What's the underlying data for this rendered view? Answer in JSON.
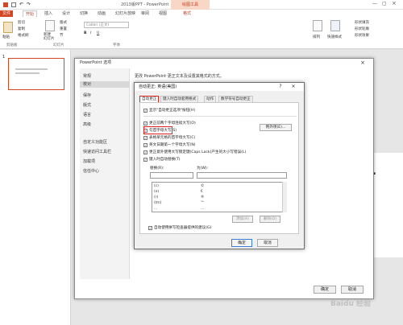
{
  "app": {
    "window_title": "2013版PPT - PowerPoint",
    "context_tools": "绘图工具"
  },
  "ribbon_tabs": [
    "文件",
    "开始",
    "插入",
    "设计",
    "切换",
    "动画",
    "幻灯片放映",
    "审阅",
    "视图",
    "格式"
  ],
  "ribbon_groups": {
    "clipboard": "剪贴板",
    "slides": "幻灯片",
    "font": "字体",
    "paste": "粘贴",
    "cut": "剪切",
    "copy": "复制",
    "format_painter": "格式刷",
    "new_slide": "新建\n幻灯片",
    "layout": "版式",
    "reset": "重置",
    "section": "节",
    "font_name": "Calibri (正文)",
    "arrange": "排列",
    "quick_styles": "快速样式",
    "shape_fill": "形状填充",
    "shape_outline": "形状轮廓",
    "shape_effects": "形状效果"
  },
  "slide_pane": {
    "slide_number": "1"
  },
  "options_dialog": {
    "title": "PowerPoint 选项",
    "header": "更改 PowerPoint 更正文本及设置其格式的方式。",
    "nav": [
      "常规",
      "校对",
      "保存",
      "版式",
      "语言",
      "高级",
      "",
      "自定义功能区",
      "快速访问工具栏",
      "",
      "加载项",
      "信任中心"
    ],
    "selected_nav": "校对",
    "ok": "确定",
    "cancel": "取消"
  },
  "autocorrect_dialog": {
    "title": "自动更正: 英语(美国)",
    "help": "?",
    "close": "×",
    "tabs": [
      "自动更正",
      "键入时自动套用格式",
      "动作",
      "数学符号自动更正"
    ],
    "active_tab": "自动更正",
    "show_buttons": "显示\"自动更正选项\"按钮(H)",
    "checkboxes": [
      {
        "label": "更正前两个字母连续大写(O)",
        "checked": true
      },
      {
        "label": "句首字母大写(S)",
        "checked": true
      },
      {
        "label": "表格单元格的首字母大写(C)",
        "checked": true
      },
      {
        "label": "英文日期第一个字母大写(N)",
        "checked": true
      },
      {
        "label": "更正意外使用大写锁定键(Caps Lock)产生的大小写错误(L)",
        "checked": true
      },
      {
        "label": "键入时自动替换(T)",
        "checked": true
      }
    ],
    "exceptions_button": "例外项(E)...",
    "replace_label": "替换(R):",
    "with_label": "为(W):",
    "replace_value": "",
    "with_value": "",
    "list_rows": [
      {
        "replace": "(c)",
        "with": "©"
      },
      {
        "replace": "(e)",
        "with": "€"
      },
      {
        "replace": "(r)",
        "with": "®"
      },
      {
        "replace": "(tm)",
        "with": "™"
      },
      {
        "replace": "...",
        "with": "…"
      }
    ],
    "add_button": "添加(A)",
    "delete_button": "删除(D)",
    "auto_suggest": "自动使用拼写检查器提供的建议(G)",
    "ok": "确定",
    "cancel": "取消"
  },
  "partial_slide_text": "t.",
  "watermark": "Baidu 经验"
}
